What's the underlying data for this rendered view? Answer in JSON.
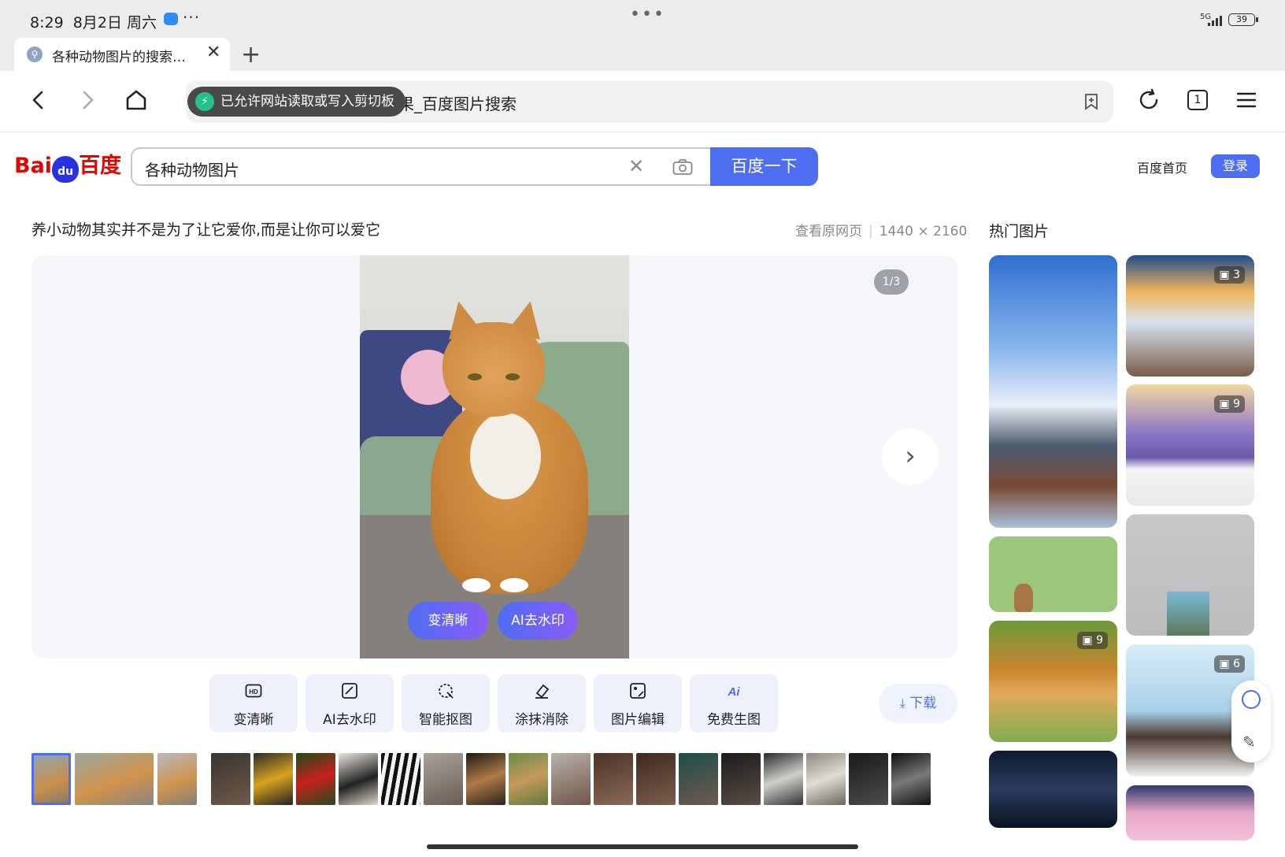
{
  "status": {
    "time": "8:29",
    "date": "8月2日 周六",
    "more": "···",
    "center_dots": "•••",
    "network": "5G",
    "battery": "39"
  },
  "tabs": [
    {
      "title": "各种动物图片的搜索…",
      "close": "✕"
    }
  ],
  "new_tab_label": "+",
  "toolbar": {
    "url": "果_百度图片搜索",
    "toast": "已允许网站读取或写入剪切板",
    "tab_count": "1"
  },
  "header": {
    "logo_en": "Bai",
    "logo_paw": "du",
    "logo_cn": "百度",
    "query": "各种动物图片",
    "search_button": "百度一下",
    "home_link": "百度首页",
    "login": "登录"
  },
  "result": {
    "caption": "养小动物其实并不是为了让它爱你,而是让你可以爱它",
    "view_source": "查看原网页",
    "dimensions": "1440 × 2160",
    "counter": "1/3",
    "btn_enhance": "变清晰",
    "btn_dewatermark": "AI去水印"
  },
  "tools": [
    {
      "label": "变清晰",
      "icon": "hd-icon"
    },
    {
      "label": "AI去水印",
      "icon": "ai-watermark-icon"
    },
    {
      "label": "智能抠图",
      "icon": "smart-cutout-icon"
    },
    {
      "label": "涂抹消除",
      "icon": "eraser-icon"
    },
    {
      "label": "图片编辑",
      "icon": "image-edit-icon"
    },
    {
      "label": "免费生图",
      "icon": "ai-generate-icon"
    }
  ],
  "download_label": "下载",
  "hot": {
    "title": "热门图片",
    "badges": [
      "3",
      "9",
      "9",
      "6"
    ]
  },
  "colors": {
    "accent": "#4e6ef2",
    "baidu_red": "#e10601",
    "baidu_blue": "#2932e1"
  }
}
